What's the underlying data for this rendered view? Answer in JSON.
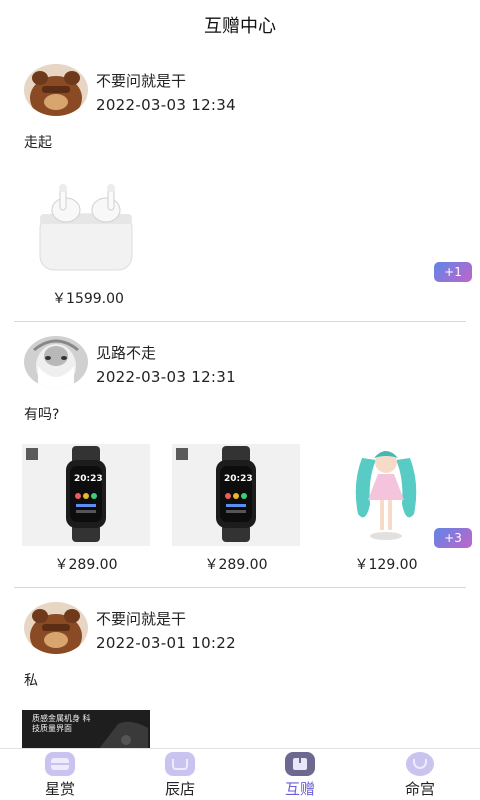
{
  "header": {
    "title": "互赠中心"
  },
  "posts": [
    {
      "username": "不要问就是干",
      "time": "2022-03-03 12:34",
      "text": "走起",
      "items": [
        {
          "price": "￥1599.00"
        }
      ],
      "badge": "+1"
    },
    {
      "username": "见路不走",
      "time": "2022-03-03 12:31",
      "text": "有吗?",
      "items": [
        {
          "price": "￥289.00"
        },
        {
          "price": "￥289.00"
        },
        {
          "price": "￥129.00"
        }
      ],
      "badge": "+3",
      "watch_face": "20:23"
    },
    {
      "username": "不要问就是干",
      "time": "2022-03-01 10:22",
      "text": "私",
      "items": [
        {
          "caption": "质感金属机身 科技质量界面"
        }
      ]
    }
  ],
  "nav": [
    {
      "label": "星赏"
    },
    {
      "label": "辰店"
    },
    {
      "label": "互赠",
      "active": true
    },
    {
      "label": "命宫"
    }
  ],
  "colors": {
    "accent": "#6a5fd8",
    "badge_from": "#5f86e8",
    "badge_to": "#c164c8"
  }
}
